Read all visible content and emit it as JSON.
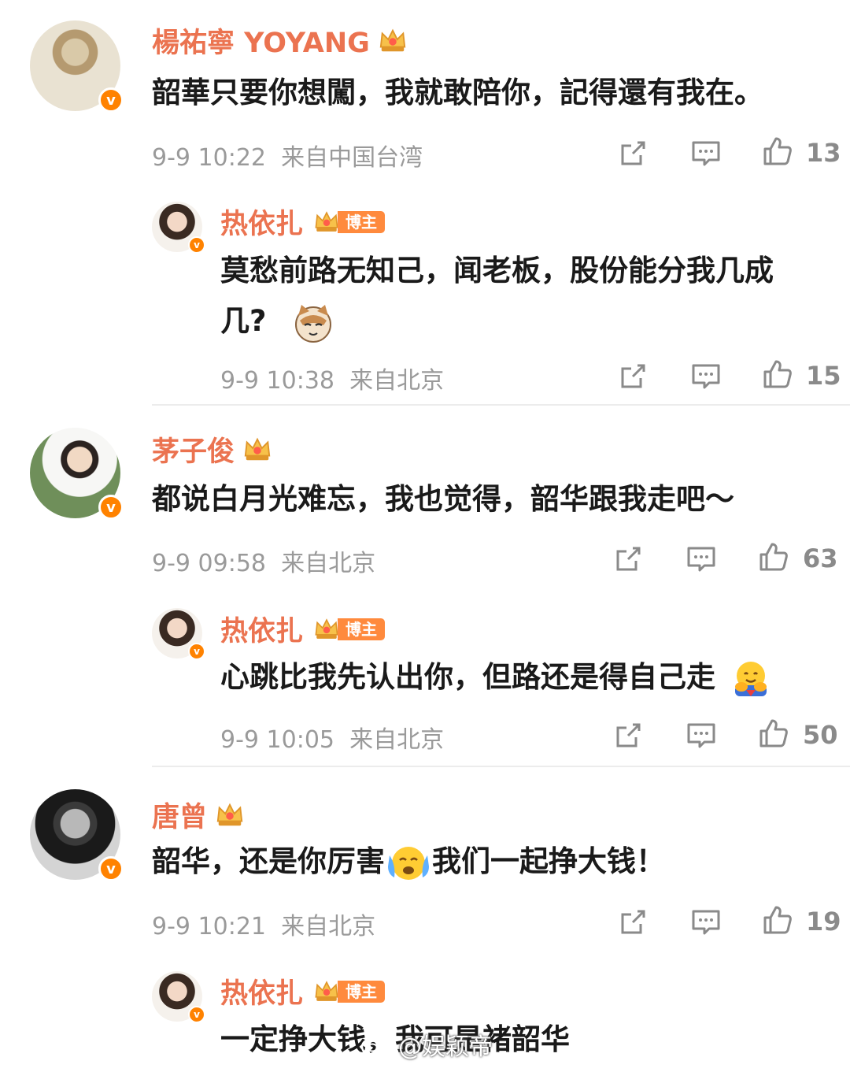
{
  "comments": [
    {
      "name": "楊祐寧 YOYANG",
      "text": "韶華只要你想闖，我就敢陪你，記得還有我在。",
      "time": "9-9 10:22",
      "source": "来自中国台湾",
      "likes": "13",
      "reply": {
        "name": "热依扎",
        "tag": "博主",
        "text_line1": "莫愁前路无知己，闻老板，股份能分我几成",
        "text_line2": "几?",
        "time": "9-9 10:38",
        "source": "来自北京",
        "likes": "15"
      }
    },
    {
      "name": "茅子俊",
      "text": "都说白月光难忘，我也觉得，韶华跟我走吧～",
      "time": "9-9 09:58",
      "source": "来自北京",
      "likes": "63",
      "reply": {
        "name": "热依扎",
        "tag": "博主",
        "text_line1": "心跳比我先认出你，但路还是得自己走",
        "time": "9-9 10:05",
        "source": "来自北京",
        "likes": "50"
      }
    },
    {
      "name": "唐曾",
      "text_part1": "韶华，还是你厉害",
      "text_part2": "我们一起挣大钱！",
      "time": "9-9 10:21",
      "source": "来自北京",
      "likes": "19",
      "reply": {
        "name": "热依扎",
        "tag": "博主",
        "text_line1": "一定挣大钱，我可是褚韶华"
      }
    }
  ],
  "watermark": "@娱颖帝",
  "colors": {
    "name": "#eb7350",
    "badge": "#ff8200",
    "meta": "#9a9a9a"
  },
  "icons": [
    "share-icon",
    "comment-icon",
    "like-icon",
    "verified-icon",
    "crown-icon"
  ]
}
